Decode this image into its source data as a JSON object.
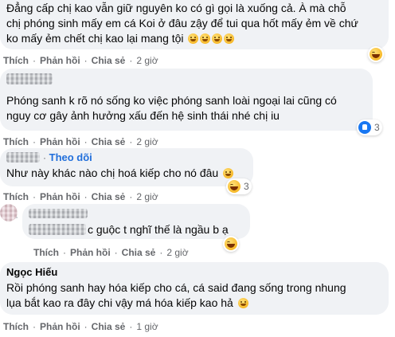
{
  "comments": [
    {
      "lines": [
        "Đẳng cấp chị kao vẫn giữ nguyên ko có gì gọi là xuống cả. À mà chỗ",
        "chị phóng sinh mấy em cá Koi ở đâu zậy để tui qua hốt mấy ẻm về chứ",
        "ko mấy ẻm chết chị kao lại mang tội"
      ],
      "actions": {
        "like": "Thích",
        "reply": "Phản hồi",
        "share": "Chia sẻ",
        "time": "2 giờ"
      }
    },
    {
      "lines": [
        "Phóng sanh k rõ nó sống ko việc phóng sanh loài ngoại lai cũng có",
        "nguy cơ gây ảnh hưởng xấu đến hệ sinh thái nhé chị iu"
      ],
      "reaction_count": "3",
      "actions": {
        "like": "Thích",
        "reply": "Phản hồi",
        "share": "Chia sẻ",
        "time": "2 giờ"
      }
    },
    {
      "follow_label": "Theo dõi",
      "lines": [
        "Như này khác nào chị hoá kiếp cho nó đâu"
      ],
      "reaction_count": "3",
      "actions": {
        "like": "Thích",
        "reply": "Phản hồi",
        "share": "Chia sẻ",
        "time": "2 giờ"
      }
    },
    {
      "lines": [
        "c guộc t nghĩ thế là ngầu b ạ"
      ],
      "actions": {
        "like": "Thích",
        "reply": "Phản hồi",
        "share": "Chia sẻ",
        "time": "2 giờ"
      }
    },
    {
      "author": "Ngọc Hiếu",
      "lines": [
        "Rồi phóng sanh hay hóa kiếp cho cá, cá said đang sống trong nhung",
        "lụa bắt kao ra đây chi vậy má hóa kiếp kao hả"
      ],
      "actions": {
        "like": "Thích",
        "reply": "Phản hồi",
        "share": "Chia sẻ",
        "time": "1 giờ"
      }
    }
  ],
  "separator": "·",
  "icons": {
    "emoji": "grinning-face-icon",
    "haha": "haha-reaction-icon",
    "like": "like-reaction-icon"
  },
  "colors": {
    "bubble": "#f0f2f5",
    "meta": "#65676b",
    "link": "#216fdb"
  }
}
